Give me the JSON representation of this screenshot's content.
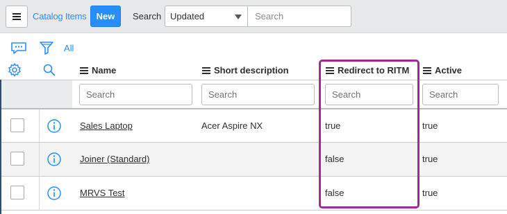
{
  "header": {
    "menu_icon": "hamburger-menu-icon",
    "title": "Catalog Items",
    "new_button_label": "New",
    "search_label": "Search",
    "search_field_selected": "Updated",
    "search_placeholder": "Search"
  },
  "toolbar": {
    "conversation_icon": "chat-bubble-icon",
    "filter_icon": "funnel-filter-icon",
    "breadcrumb_all": "All",
    "settings_icon": "gear-icon",
    "search_icon": "magnifier-icon"
  },
  "columns": [
    {
      "label": "Name",
      "search_placeholder": "Search"
    },
    {
      "label": "Short description",
      "search_placeholder": "Search"
    },
    {
      "label": "Redirect to RITM",
      "search_placeholder": "Search"
    },
    {
      "label": "Active",
      "search_placeholder": "Search"
    }
  ],
  "rows": [
    {
      "name": "Sales Laptop",
      "short_description": "Acer Aspire NX",
      "redirect_to_ritm": "true",
      "active": "true"
    },
    {
      "name": "Joiner (Standard)",
      "short_description": "",
      "redirect_to_ritm": "false",
      "active": "true"
    },
    {
      "name": "MRVS Test",
      "short_description": "",
      "redirect_to_ritm": "false",
      "active": "true"
    }
  ],
  "colors": {
    "accent": "#278efc",
    "highlight_border": "#a02b93",
    "header_bg": "#e6e8ea",
    "odd_row_bg": "#f3f3f3"
  }
}
